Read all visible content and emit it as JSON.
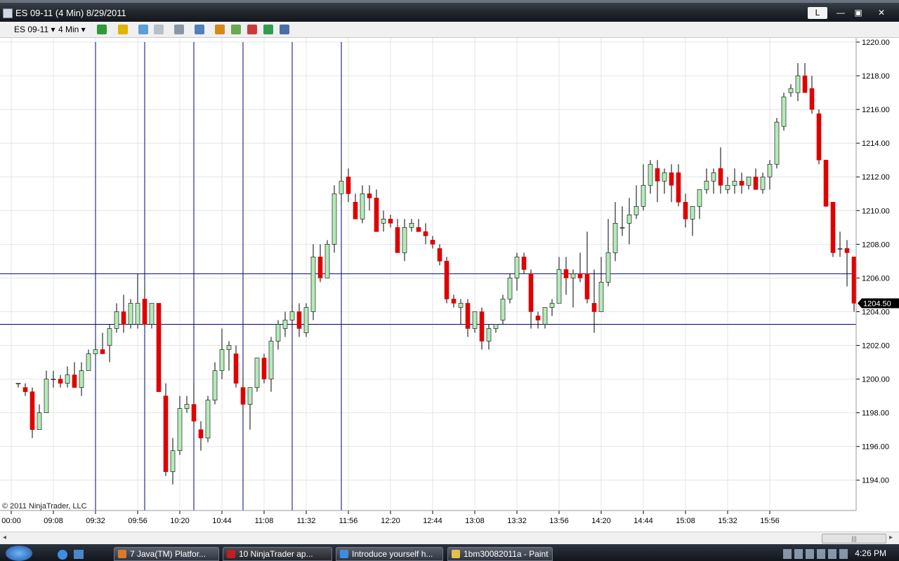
{
  "window": {
    "title": "ES 09-11 (4 Min)  8/29/2011",
    "btn_l": "L",
    "btn_min": "—",
    "btn_max": "▣",
    "btn_close": "✕"
  },
  "toolbar": {
    "instrument": "ES 09-11",
    "interval": "4 Min"
  },
  "copyright": "© 2011 NinjaTrader, LLC",
  "price_marker": "1204.50",
  "scroll": {
    "grip": "|||"
  },
  "taskbar": {
    "items": [
      "7 Java(TM) Platfor...",
      "10 NinjaTrader ap...",
      "Introduce yourself h...",
      "1bm30082011a - Paint"
    ],
    "clock": "4:26 PM"
  },
  "colors": {
    "up": "#b5eab9",
    "down": "#e00000",
    "marker": "#000000"
  },
  "chart_data": {
    "type": "candlestick",
    "x_tick_labels": [
      "00:00",
      "09:08",
      "09:32",
      "09:56",
      "10:20",
      "10:44",
      "11:08",
      "11:32",
      "11:56",
      "12:20",
      "12:44",
      "13:08",
      "13:32",
      "13:56",
      "14:20",
      "14:44",
      "15:08",
      "15:32",
      "15:56"
    ],
    "y_tick_labels": [
      "1194.00",
      "1196.00",
      "1198.00",
      "1200.00",
      "1202.00",
      "1204.00",
      "1206.00",
      "1208.00",
      "1210.00",
      "1212.00",
      "1214.00",
      "1216.00",
      "1218.00",
      "1220.00"
    ],
    "ylim": [
      1192.2,
      1220.25
    ],
    "grid": true,
    "last_price": 1204.5,
    "horizontal_lines": [
      1206.25,
      1203.25
    ],
    "vertical_lines_at_bars": [
      12,
      19,
      26,
      33,
      40,
      47
    ],
    "candles": [
      {
        "o": 1199.75,
        "h": 1199.75,
        "l": 1199.5,
        "c": 1199.75
      },
      {
        "o": 1199.5,
        "h": 1199.75,
        "l": 1199.0,
        "c": 1199.25
      },
      {
        "o": 1199.25,
        "h": 1199.5,
        "l": 1196.5,
        "c": 1197.0
      },
      {
        "o": 1197.0,
        "h": 1198.5,
        "l": 1197.0,
        "c": 1198.0
      },
      {
        "o": 1198.0,
        "h": 1200.5,
        "l": 1198.0,
        "c": 1200.0
      },
      {
        "o": 1200.0,
        "h": 1200.5,
        "l": 1199.5,
        "c": 1200.0
      },
      {
        "o": 1200.0,
        "h": 1200.25,
        "l": 1199.5,
        "c": 1199.75
      },
      {
        "o": 1199.75,
        "h": 1200.75,
        "l": 1199.5,
        "c": 1200.25
      },
      {
        "o": 1200.25,
        "h": 1201.0,
        "l": 1199.5,
        "c": 1199.5
      },
      {
        "o": 1199.5,
        "h": 1201.0,
        "l": 1199.0,
        "c": 1200.5
      },
      {
        "o": 1200.5,
        "h": 1201.75,
        "l": 1200.5,
        "c": 1201.5
      },
      {
        "o": 1201.5,
        "h": 1202.25,
        "l": 1201.5,
        "c": 1201.75
      },
      {
        "o": 1201.75,
        "h": 1202.75,
        "l": 1201.5,
        "c": 1201.5
      },
      {
        "o": 1202.0,
        "h": 1203.25,
        "l": 1201.0,
        "c": 1203.0
      },
      {
        "o": 1203.0,
        "h": 1204.5,
        "l": 1202.75,
        "c": 1204.0
      },
      {
        "o": 1204.0,
        "h": 1205.0,
        "l": 1202.75,
        "c": 1203.25
      },
      {
        "o": 1203.25,
        "h": 1204.75,
        "l": 1203.0,
        "c": 1204.5
      },
      {
        "o": 1203.25,
        "h": 1206.25,
        "l": 1203.0,
        "c": 1204.5
      },
      {
        "o": 1204.75,
        "h": 1205.5,
        "l": 1203.0,
        "c": 1203.25
      },
      {
        "o": 1203.25,
        "h": 1204.5,
        "l": 1203.0,
        "c": 1204.5
      },
      {
        "o": 1204.5,
        "h": 1204.5,
        "l": 1199.25,
        "c": 1199.25
      },
      {
        "o": 1199.0,
        "h": 1199.75,
        "l": 1194.25,
        "c": 1194.5
      },
      {
        "o": 1194.5,
        "h": 1196.5,
        "l": 1193.75,
        "c": 1195.75
      },
      {
        "o": 1195.75,
        "h": 1199.0,
        "l": 1195.5,
        "c": 1198.25
      },
      {
        "o": 1198.25,
        "h": 1199.0,
        "l": 1198.0,
        "c": 1198.5
      },
      {
        "o": 1198.5,
        "h": 1199.75,
        "l": 1197.25,
        "c": 1197.5
      },
      {
        "o": 1197.0,
        "h": 1197.5,
        "l": 1195.75,
        "c": 1196.5
      },
      {
        "o": 1196.5,
        "h": 1199.0,
        "l": 1196.25,
        "c": 1198.75
      },
      {
        "o": 1198.75,
        "h": 1201.0,
        "l": 1198.5,
        "c": 1200.5
      },
      {
        "o": 1200.5,
        "h": 1203.0,
        "l": 1200.0,
        "c": 1201.75
      },
      {
        "o": 1201.75,
        "h": 1202.25,
        "l": 1200.5,
        "c": 1202.0
      },
      {
        "o": 1201.5,
        "h": 1202.0,
        "l": 1199.5,
        "c": 1199.75
      },
      {
        "o": 1199.5,
        "h": 1200.25,
        "l": 1197.75,
        "c": 1198.5
      },
      {
        "o": 1198.5,
        "h": 1199.5,
        "l": 1197.0,
        "c": 1199.5
      },
      {
        "o": 1199.5,
        "h": 1201.25,
        "l": 1199.25,
        "c": 1201.25
      },
      {
        "o": 1201.25,
        "h": 1201.5,
        "l": 1199.75,
        "c": 1200.0
      },
      {
        "o": 1200.0,
        "h": 1202.5,
        "l": 1199.25,
        "c": 1202.25
      },
      {
        "o": 1202.25,
        "h": 1203.5,
        "l": 1201.75,
        "c": 1203.25
      },
      {
        "o": 1203.0,
        "h": 1204.0,
        "l": 1202.5,
        "c": 1203.5
      },
      {
        "o": 1203.5,
        "h": 1204.5,
        "l": 1203.0,
        "c": 1204.0
      },
      {
        "o": 1204.0,
        "h": 1204.5,
        "l": 1202.5,
        "c": 1203.0
      },
      {
        "o": 1202.75,
        "h": 1204.5,
        "l": 1202.5,
        "c": 1204.25
      },
      {
        "o": 1204.0,
        "h": 1208.0,
        "l": 1203.5,
        "c": 1207.25
      },
      {
        "o": 1207.25,
        "h": 1208.0,
        "l": 1205.75,
        "c": 1206.0
      },
      {
        "o": 1206.0,
        "h": 1208.25,
        "l": 1206.0,
        "c": 1208.0
      },
      {
        "o": 1208.0,
        "h": 1211.5,
        "l": 1207.5,
        "c": 1211.0
      },
      {
        "o": 1211.0,
        "h": 1213.0,
        "l": 1210.5,
        "c": 1211.75
      },
      {
        "o": 1212.0,
        "h": 1212.5,
        "l": 1210.5,
        "c": 1211.0
      },
      {
        "o": 1210.5,
        "h": 1211.0,
        "l": 1209.5,
        "c": 1209.5
      },
      {
        "o": 1209.5,
        "h": 1211.5,
        "l": 1209.25,
        "c": 1211.0
      },
      {
        "o": 1211.0,
        "h": 1211.5,
        "l": 1210.0,
        "c": 1210.75
      },
      {
        "o": 1210.75,
        "h": 1211.25,
        "l": 1208.75,
        "c": 1208.75
      },
      {
        "o": 1209.25,
        "h": 1210.0,
        "l": 1208.75,
        "c": 1209.5
      },
      {
        "o": 1209.5,
        "h": 1209.75,
        "l": 1209.0,
        "c": 1209.25
      },
      {
        "o": 1209.0,
        "h": 1209.5,
        "l": 1207.5,
        "c": 1207.5
      },
      {
        "o": 1207.5,
        "h": 1209.5,
        "l": 1207.0,
        "c": 1209.0
      },
      {
        "o": 1209.0,
        "h": 1209.5,
        "l": 1208.75,
        "c": 1209.25
      },
      {
        "o": 1209.0,
        "h": 1209.5,
        "l": 1208.75,
        "c": 1208.75
      },
      {
        "o": 1208.75,
        "h": 1209.25,
        "l": 1208.0,
        "c": 1208.5
      },
      {
        "o": 1208.25,
        "h": 1208.5,
        "l": 1207.75,
        "c": 1208.0
      },
      {
        "o": 1207.75,
        "h": 1208.0,
        "l": 1206.75,
        "c": 1207.0
      },
      {
        "o": 1207.0,
        "h": 1207.25,
        "l": 1204.5,
        "c": 1204.75
      },
      {
        "o": 1204.75,
        "h": 1205.0,
        "l": 1204.25,
        "c": 1204.5
      },
      {
        "o": 1204.25,
        "h": 1204.75,
        "l": 1203.25,
        "c": 1204.5
      },
      {
        "o": 1204.5,
        "h": 1204.75,
        "l": 1202.5,
        "c": 1203.0
      },
      {
        "o": 1203.0,
        "h": 1204.0,
        "l": 1202.75,
        "c": 1204.0
      },
      {
        "o": 1204.0,
        "h": 1204.25,
        "l": 1201.75,
        "c": 1202.25
      },
      {
        "o": 1202.25,
        "h": 1203.25,
        "l": 1201.75,
        "c": 1203.0
      },
      {
        "o": 1203.0,
        "h": 1203.25,
        "l": 1202.75,
        "c": 1203.25
      },
      {
        "o": 1203.5,
        "h": 1205.0,
        "l": 1203.25,
        "c": 1204.75
      },
      {
        "o": 1204.75,
        "h": 1206.25,
        "l": 1204.5,
        "c": 1206.0
      },
      {
        "o": 1206.0,
        "h": 1207.5,
        "l": 1205.25,
        "c": 1207.25
      },
      {
        "o": 1207.25,
        "h": 1207.5,
        "l": 1206.25,
        "c": 1206.5
      },
      {
        "o": 1206.25,
        "h": 1206.5,
        "l": 1203.0,
        "c": 1204.0
      },
      {
        "o": 1203.75,
        "h": 1204.0,
        "l": 1203.0,
        "c": 1203.5
      },
      {
        "o": 1203.25,
        "h": 1204.25,
        "l": 1203.0,
        "c": 1204.25
      },
      {
        "o": 1204.25,
        "h": 1204.75,
        "l": 1203.75,
        "c": 1204.5
      },
      {
        "o": 1204.5,
        "h": 1207.25,
        "l": 1204.5,
        "c": 1206.5
      },
      {
        "o": 1206.5,
        "h": 1207.25,
        "l": 1205.0,
        "c": 1206.0
      },
      {
        "o": 1206.0,
        "h": 1206.5,
        "l": 1204.25,
        "c": 1206.25
      },
      {
        "o": 1206.25,
        "h": 1207.5,
        "l": 1205.75,
        "c": 1206.0
      },
      {
        "o": 1206.25,
        "h": 1208.75,
        "l": 1204.5,
        "c": 1204.75
      },
      {
        "o": 1204.5,
        "h": 1206.5,
        "l": 1202.75,
        "c": 1204.0
      },
      {
        "o": 1204.0,
        "h": 1207.25,
        "l": 1204.0,
        "c": 1205.75
      },
      {
        "o": 1205.75,
        "h": 1209.5,
        "l": 1205.5,
        "c": 1207.5
      },
      {
        "o": 1207.5,
        "h": 1210.5,
        "l": 1207.0,
        "c": 1209.25
      },
      {
        "o": 1209.0,
        "h": 1210.25,
        "l": 1208.5,
        "c": 1209.0
      },
      {
        "o": 1209.25,
        "h": 1210.75,
        "l": 1208.0,
        "c": 1209.75
      },
      {
        "o": 1209.75,
        "h": 1211.5,
        "l": 1209.5,
        "c": 1210.25
      },
      {
        "o": 1210.25,
        "h": 1212.75,
        "l": 1210.0,
        "c": 1211.5
      },
      {
        "o": 1211.5,
        "h": 1213.0,
        "l": 1211.0,
        "c": 1212.75
      },
      {
        "o": 1212.5,
        "h": 1213.0,
        "l": 1210.5,
        "c": 1211.75
      },
      {
        "o": 1211.75,
        "h": 1212.5,
        "l": 1211.0,
        "c": 1212.25
      },
      {
        "o": 1212.25,
        "h": 1212.75,
        "l": 1210.5,
        "c": 1211.5
      },
      {
        "o": 1212.25,
        "h": 1212.75,
        "l": 1210.25,
        "c": 1210.5
      },
      {
        "o": 1210.5,
        "h": 1211.0,
        "l": 1209.0,
        "c": 1209.5
      },
      {
        "o": 1209.5,
        "h": 1210.25,
        "l": 1208.5,
        "c": 1210.25
      },
      {
        "o": 1210.25,
        "h": 1211.25,
        "l": 1209.5,
        "c": 1211.25
      },
      {
        "o": 1211.25,
        "h": 1212.5,
        "l": 1211.0,
        "c": 1211.75
      },
      {
        "o": 1211.75,
        "h": 1212.5,
        "l": 1211.0,
        "c": 1212.25
      },
      {
        "o": 1212.5,
        "h": 1213.75,
        "l": 1211.0,
        "c": 1211.5
      },
      {
        "o": 1211.25,
        "h": 1212.0,
        "l": 1211.0,
        "c": 1211.5
      },
      {
        "o": 1211.5,
        "h": 1212.5,
        "l": 1211.0,
        "c": 1211.75
      },
      {
        "o": 1211.75,
        "h": 1212.25,
        "l": 1211.0,
        "c": 1211.5
      },
      {
        "o": 1211.5,
        "h": 1212.0,
        "l": 1211.25,
        "c": 1212.0
      },
      {
        "o": 1212.0,
        "h": 1212.5,
        "l": 1211.5,
        "c": 1211.25
      },
      {
        "o": 1211.25,
        "h": 1212.25,
        "l": 1211.0,
        "c": 1212.0
      },
      {
        "o": 1212.0,
        "h": 1213.0,
        "l": 1211.25,
        "c": 1212.75
      },
      {
        "o": 1212.75,
        "h": 1215.5,
        "l": 1212.5,
        "c": 1215.25
      },
      {
        "o": 1215.0,
        "h": 1217.0,
        "l": 1214.75,
        "c": 1216.75
      },
      {
        "o": 1217.0,
        "h": 1217.5,
        "l": 1216.75,
        "c": 1217.25
      },
      {
        "o": 1217.0,
        "h": 1218.75,
        "l": 1216.5,
        "c": 1218.0
      },
      {
        "o": 1218.0,
        "h": 1218.75,
        "l": 1217.0,
        "c": 1217.0
      },
      {
        "o": 1217.25,
        "h": 1218.0,
        "l": 1215.75,
        "c": 1216.0
      },
      {
        "o": 1215.75,
        "h": 1216.0,
        "l": 1212.75,
        "c": 1213.0
      },
      {
        "o": 1213.0,
        "h": 1213.0,
        "l": 1210.5,
        "c": 1210.25
      },
      {
        "o": 1210.5,
        "h": 1210.5,
        "l": 1207.25,
        "c": 1207.5
      },
      {
        "o": 1207.75,
        "h": 1208.75,
        "l": 1207.25,
        "c": 1207.75
      },
      {
        "o": 1207.75,
        "h": 1208.25,
        "l": 1205.5,
        "c": 1207.5
      },
      {
        "o": 1207.25,
        "h": 1207.25,
        "l": 1204.0,
        "c": 1204.5
      }
    ]
  }
}
